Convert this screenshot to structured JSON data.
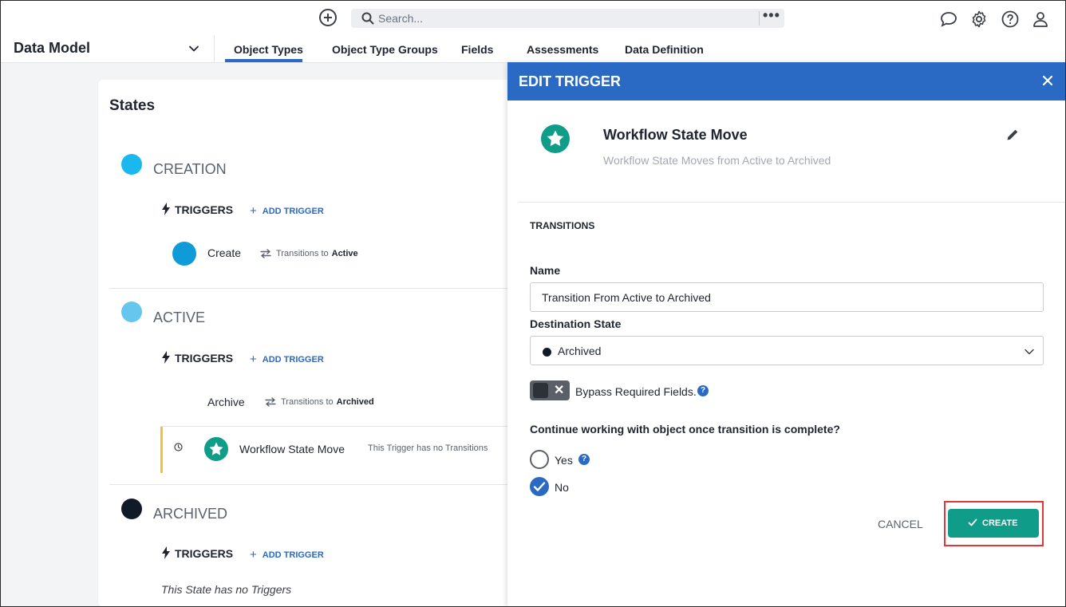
{
  "search": {
    "placeholder": "Search..."
  },
  "module": {
    "label": "Data Model"
  },
  "tabs": [
    {
      "label": "Object Types",
      "active": true
    },
    {
      "label": "Object Type Groups"
    },
    {
      "label": "Fields"
    },
    {
      "label": "Assessments"
    },
    {
      "label": "Data Definition"
    }
  ],
  "states_card": {
    "title": "States",
    "triggers_label": "TRIGGERS",
    "add_trigger_label": "ADD TRIGGER",
    "transitions_to_label": "Transitions to",
    "states": [
      {
        "name": "CREATION",
        "color": "#1bb8f0",
        "trigger": {
          "name": "Create",
          "target": "Active",
          "color": "#0f9ad8"
        }
      },
      {
        "name": "ACTIVE",
        "color": "#66c6ee",
        "trigger": {
          "name": "Archive",
          "target": "Archived"
        },
        "sub_trigger": {
          "name": "Workflow State Move",
          "note": "This Trigger has no Transitions"
        }
      },
      {
        "name": "ARCHIVED",
        "color": "#111a27",
        "empty_text": "This State has no Triggers"
      }
    ]
  },
  "panel": {
    "title": "EDIT TRIGGER",
    "trigger_title": "Workflow State Move",
    "trigger_subtitle": "Workflow State Moves from Active to Archived",
    "section": "TRANSITIONS",
    "name_label": "Name",
    "name_value": "Transition From Active to Archived",
    "destination_label": "Destination State",
    "destination_value": "Archived",
    "bypass_label": "Bypass Required Fields.",
    "bypass_on": false,
    "question": "Continue working with object once transition is complete?",
    "options": [
      {
        "label": "Yes",
        "selected": false
      },
      {
        "label": "No",
        "selected": true
      }
    ],
    "cancel_label": "CANCEL",
    "create_label": "CREATE"
  },
  "colors": {
    "accent": "#2a6ac5",
    "teal": "#0f9d8a",
    "highlight": "#e0373a",
    "yellow": "#f0c23a"
  }
}
